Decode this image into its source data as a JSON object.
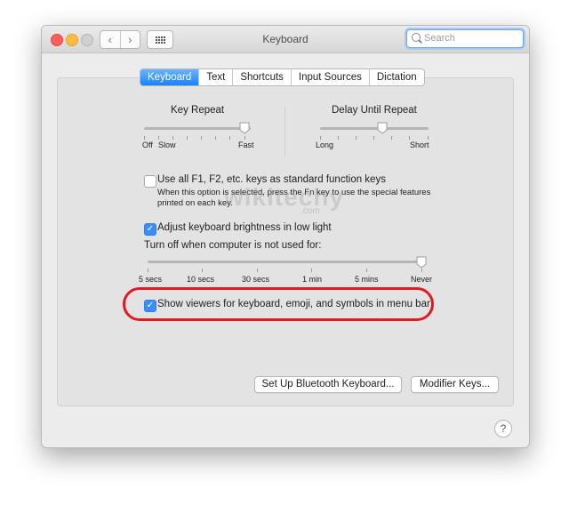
{
  "window": {
    "title": "Keyboard",
    "search_placeholder": "Search"
  },
  "tabs": [
    {
      "label": "Keyboard",
      "active": true
    },
    {
      "label": "Text",
      "active": false
    },
    {
      "label": "Shortcuts",
      "active": false
    },
    {
      "label": "Input Sources",
      "active": false
    },
    {
      "label": "Dictation",
      "active": false
    }
  ],
  "key_repeat": {
    "title": "Key Repeat",
    "labels": [
      "Off",
      "Slow",
      "Fast"
    ]
  },
  "delay_until_repeat": {
    "title": "Delay Until Repeat",
    "labels": [
      "Long",
      "Short"
    ]
  },
  "fn_keys": {
    "label": "Use all F1, F2, etc. keys as standard function keys",
    "description_line1": "When this option is selected, press the Fn key to use the special features",
    "description_line2": "printed on each key.",
    "checked": false
  },
  "brightness": {
    "label": "Adjust keyboard brightness in low light",
    "checked": true
  },
  "turn_off": {
    "label": "Turn off when computer is not used for:",
    "ticks": [
      "5 secs",
      "10 secs",
      "30 secs",
      "1 min",
      "5 mins",
      "Never"
    ]
  },
  "show_viewers": {
    "label": "Show viewers for keyboard, emoji, and symbols in menu bar",
    "checked": true
  },
  "watermark": {
    "text": "wikitechy",
    "sub": ".com"
  },
  "buttons": {
    "bluetooth": "Set Up Bluetooth Keyboard...",
    "modifier": "Modifier Keys..."
  },
  "help_symbol": "?",
  "colors": {
    "accent": "#1a82fb",
    "highlight_ring": "#e2191f"
  }
}
